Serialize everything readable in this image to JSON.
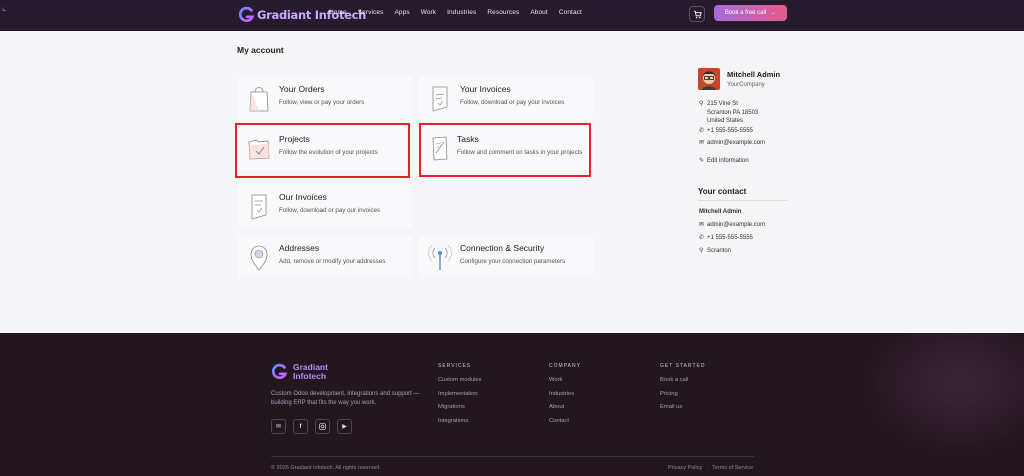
{
  "header": {
    "brand": "Gradiant Infotech",
    "nav": [
      "Home",
      "Services",
      "Apps",
      "Work",
      "Industries",
      "Resources",
      "About",
      "Contact"
    ],
    "cta_label": "Book a free call",
    "cta_arrow": "→"
  },
  "main": {
    "title": "My account",
    "cards": [
      {
        "title": "Your Orders",
        "desc": "Follow, view or pay your orders"
      },
      {
        "title": "Your Invoices",
        "desc": "Follow, download or pay your invoices"
      },
      {
        "title": "Projects",
        "desc": "Follow the evolution of your projects"
      },
      {
        "title": "Tasks",
        "desc": "Follow and comment on tasks in your projects"
      },
      {
        "title": "Our Invoices",
        "desc": "Follow, download or pay our invoices"
      },
      {
        "title": "Addresses",
        "desc": "Add, remove or modify your addresses"
      },
      {
        "title": "Connection & Security",
        "desc": "Configure your connection parameters"
      }
    ]
  },
  "profile": {
    "name": "Mitchell Admin",
    "company": "YourCompany",
    "address": [
      "215 Vine St",
      "Scranton PA 18503",
      "United States"
    ],
    "phone": "+1 555-555-5555",
    "email": "admin@example.com",
    "edit_label": "Edit information"
  },
  "your_contact": {
    "title": "Your contact",
    "name": "Mitchell Admin",
    "email": "admin@example.com",
    "phone": "+1 555-555-5555",
    "city": "Scranton"
  },
  "footer": {
    "brand_line1": "Gradiant",
    "brand_line2": "Infotech",
    "tagline": "Custom Odoo development, integrations and support — building ERP that fits the way you work.",
    "columns": [
      {
        "heading": "SERVICES",
        "links": [
          "Custom modules",
          "Implementation",
          "Migrations",
          "Integrations"
        ]
      },
      {
        "heading": "COMPANY",
        "links": [
          "Work",
          "Industries",
          "About",
          "Contact"
        ]
      },
      {
        "heading": "GET STARTED",
        "links": [
          "Book a call",
          "Pricing",
          "Email us"
        ]
      }
    ],
    "copyright": "© 2026 Gradiant Infotech. All rights reserved.",
    "legal": [
      "Privacy Policy",
      "·",
      "Terms of Service"
    ]
  },
  "colors": {
    "topbar": "#251b2c",
    "accent_start": "#a76bdc",
    "accent_end": "#e45a8a",
    "highlight": "#e0252a",
    "footer": "#22161f"
  },
  "icons": [
    "cart-icon",
    "orders-bag-icon",
    "invoice-icon",
    "projects-folder-icon",
    "tasks-icon",
    "our-invoices-icon",
    "address-pin-icon",
    "security-antenna-icon",
    "location-pin-icon",
    "phone-icon",
    "email-icon",
    "pencil-icon",
    "email-social-icon",
    "facebook-icon",
    "instagram-icon",
    "youtube-icon"
  ]
}
